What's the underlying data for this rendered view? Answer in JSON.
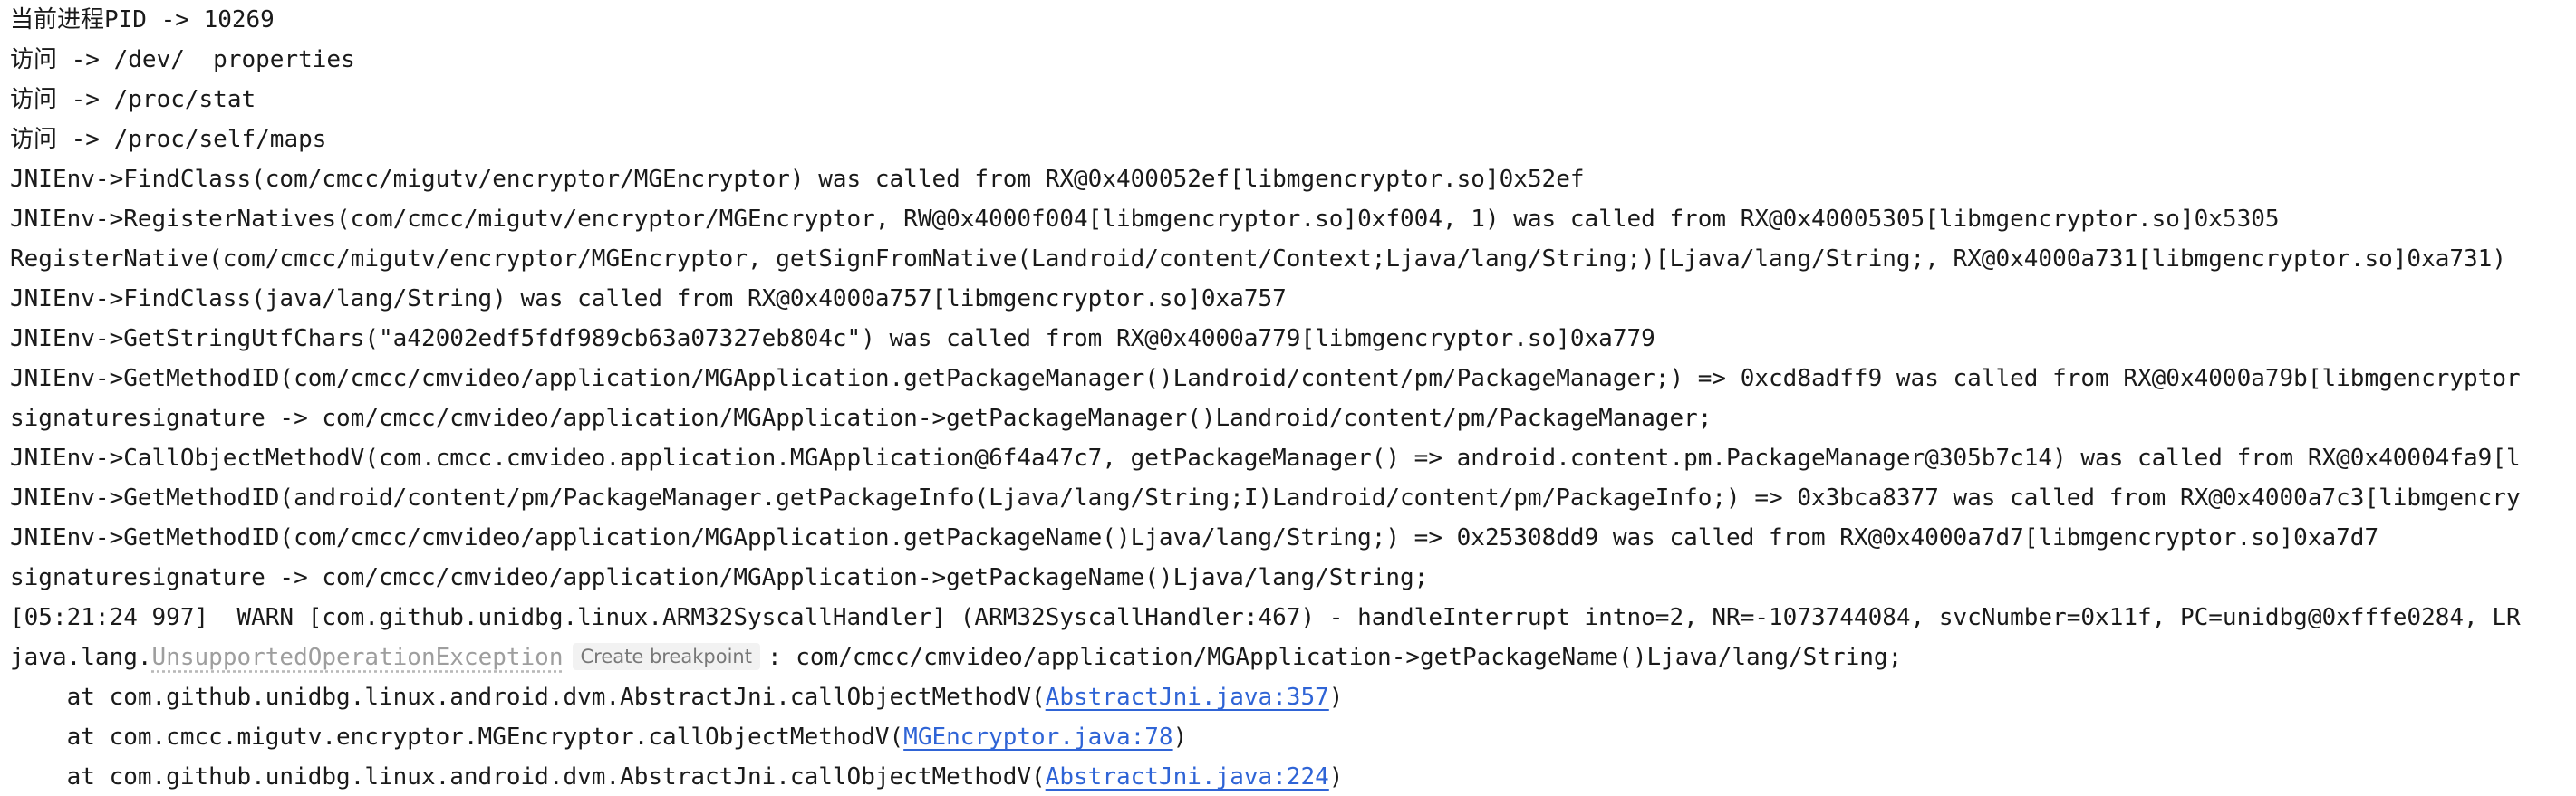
{
  "colors": {
    "background": "#ffffff",
    "text": "#1a1a1a",
    "link": "#2f64d6",
    "muted_exception": "#9e9e9e",
    "breakpoint_bg": "#f2f2f2"
  },
  "console": {
    "lines": [
      "当前进程PID -> 10269",
      "访问 -> /dev/__properties__",
      "访问 -> /proc/stat",
      "访问 -> /proc/self/maps",
      "JNIEnv->FindClass(com/cmcc/migutv/encryptor/MGEncryptor) was called from RX@0x400052ef[libmgencryptor.so]0x52ef",
      "JNIEnv->RegisterNatives(com/cmcc/migutv/encryptor/MGEncryptor, RW@0x4000f004[libmgencryptor.so]0xf004, 1) was called from RX@0x40005305[libmgencryptor.so]0x5305",
      "RegisterNative(com/cmcc/migutv/encryptor/MGEncryptor, getSignFromNative(Landroid/content/Context;Ljava/lang/String;)[Ljava/lang/String;, RX@0x4000a731[libmgencryptor.so]0xa731)",
      "JNIEnv->FindClass(java/lang/String) was called from RX@0x4000a757[libmgencryptor.so]0xa757",
      "JNIEnv->GetStringUtfChars(\"a42002edf5fdf989cb63a07327eb804c\") was called from RX@0x4000a779[libmgencryptor.so]0xa779",
      "JNIEnv->GetMethodID(com/cmcc/cmvideo/application/MGApplication.getPackageManager()Landroid/content/pm/PackageManager;) => 0xcd8adff9 was called from RX@0x4000a79b[libmgencryptor",
      "signaturesignature -> com/cmcc/cmvideo/application/MGApplication->getPackageManager()Landroid/content/pm/PackageManager;",
      "JNIEnv->CallObjectMethodV(com.cmcc.cmvideo.application.MGApplication@6f4a47c7, getPackageManager() => android.content.pm.PackageManager@305b7c14) was called from RX@0x40004fa9[l",
      "JNIEnv->GetMethodID(android/content/pm/PackageManager.getPackageInfo(Ljava/lang/String;I)Landroid/content/pm/PackageInfo;) => 0x3bca8377 was called from RX@0x4000a7c3[libmgencry",
      "JNIEnv->GetMethodID(com/cmcc/cmvideo/application/MGApplication.getPackageName()Ljava/lang/String;) => 0x25308dd9 was called from RX@0x4000a7d7[libmgencryptor.so]0xa7d7",
      "signaturesignature -> com/cmcc/cmvideo/application/MGApplication->getPackageName()Ljava/lang/String;",
      "[05:21:24 997]  WARN [com.github.unidbg.linux.ARM32SyscallHandler] (ARM32SyscallHandler:467) - handleInterrupt intno=2, NR=-1073744084, svcNumber=0x11f, PC=unidbg@0xfffe0284, LR"
    ],
    "exception": {
      "prefix": "java.lang.",
      "name": "UnsupportedOperationException",
      "breakpoint_label": "Create breakpoint",
      "message": ": com/cmcc/cmvideo/application/MGApplication->getPackageName()Ljava/lang/String;"
    },
    "stack": [
      {
        "prefix": "    at com.github.unidbg.linux.android.dvm.AbstractJni.callObjectMethodV(",
        "link": "AbstractJni.java:357",
        "suffix": ")"
      },
      {
        "prefix": "    at com.cmcc.migutv.encryptor.MGEncryptor.callObjectMethodV(",
        "link": "MGEncryptor.java:78",
        "suffix": ")"
      },
      {
        "prefix": "    at com.github.unidbg.linux.android.dvm.AbstractJni.callObjectMethodV(",
        "link": "AbstractJni.java:224",
        "suffix": ")"
      }
    ]
  }
}
